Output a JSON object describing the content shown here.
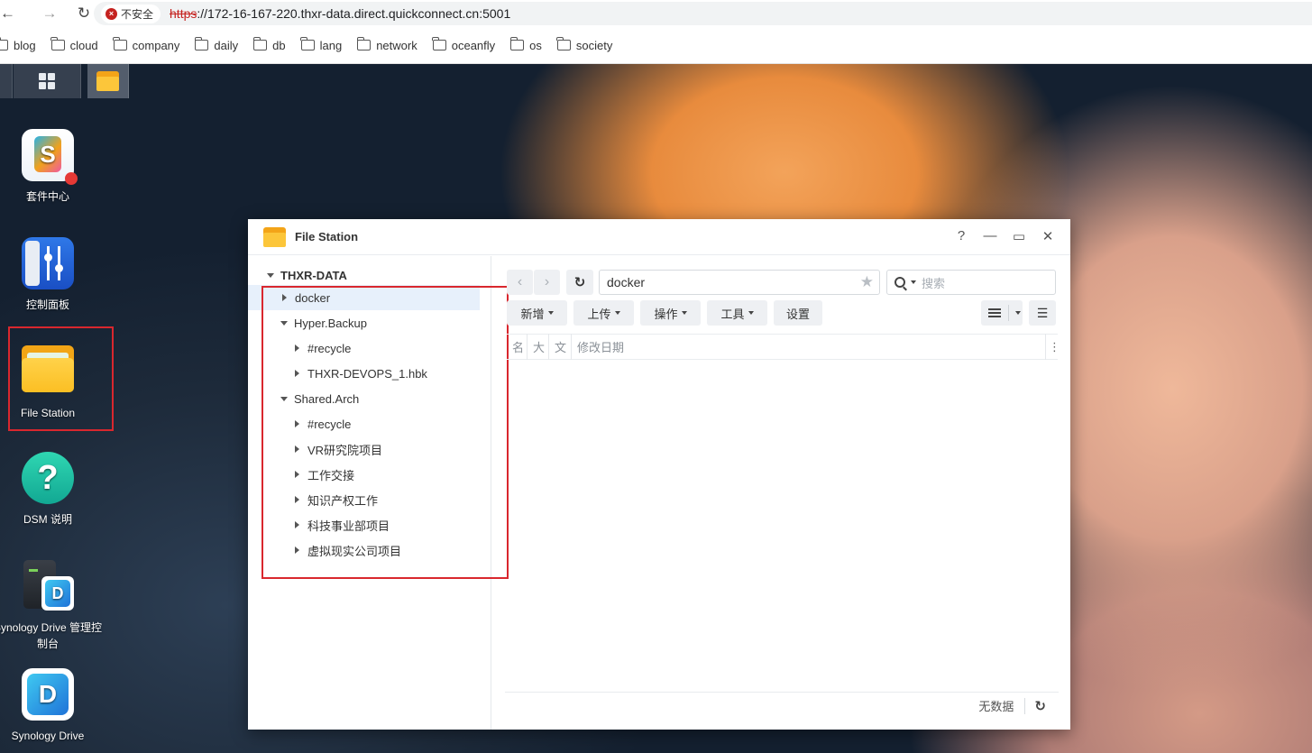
{
  "browser": {
    "security_label": "不安全",
    "url_protocol": "https",
    "url_rest": "://172-16-167-220.thxr-data.direct.quickconnect.cn:5001",
    "bookmarks": [
      "blog",
      "cloud",
      "company",
      "daily",
      "db",
      "lang",
      "network",
      "oceanfly",
      "os",
      "society"
    ]
  },
  "desktop": {
    "icons": [
      {
        "label": "套件中心"
      },
      {
        "label": "控制面板"
      },
      {
        "label": "File Station"
      },
      {
        "label": "DSM 说明"
      },
      {
        "label_line1": "Synology Drive 管理控",
        "label_line2": "制台"
      },
      {
        "label": "Synology Drive"
      }
    ]
  },
  "window": {
    "title": "File Station",
    "controls": {
      "help": "?",
      "minimize": "—",
      "maximize": "▭",
      "close": "✕"
    },
    "tree": {
      "root": "THXR-DATA",
      "nodes": [
        {
          "label": "docker"
        },
        {
          "label": "Hyper.Backup"
        },
        {
          "label": "#recycle"
        },
        {
          "label": "THXR-DEVOPS_1.hbk"
        },
        {
          "label": "Shared.Arch"
        },
        {
          "label": "#recycle"
        },
        {
          "label": "VR研究院项目"
        },
        {
          "label": "工作交接"
        },
        {
          "label": "知识产权工作"
        },
        {
          "label": "科技事业部项目"
        },
        {
          "label": "虚拟现实公司项目"
        }
      ]
    },
    "path": "docker",
    "search_placeholder": "搜索",
    "actions": {
      "create": "新增",
      "upload": "上传",
      "action": "操作",
      "tools": "工具",
      "settings": "设置"
    },
    "columns": [
      "名",
      "大",
      "文",
      "修改日期"
    ],
    "status": "无数据"
  },
  "colors": {
    "highlight_box": "#d9272e",
    "selected_row": "#e7f0fb",
    "folder": "#fcc63a"
  }
}
